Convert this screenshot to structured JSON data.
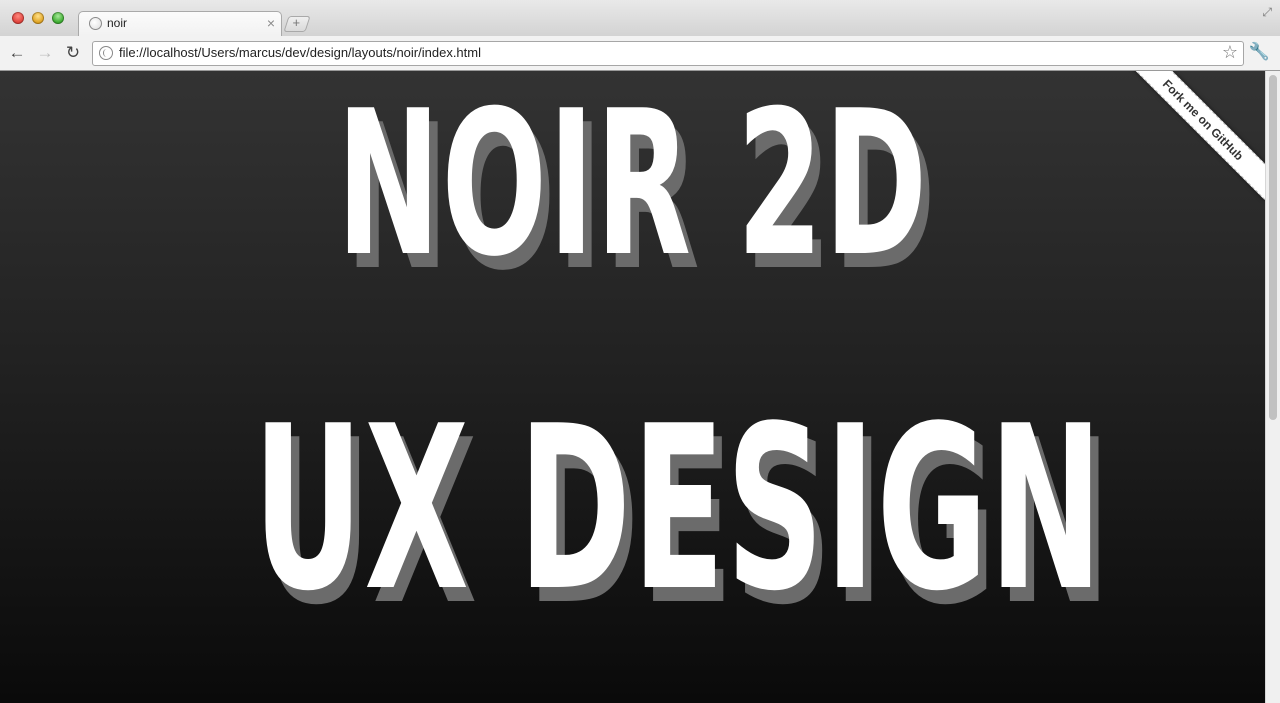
{
  "browser": {
    "tab": {
      "title": "noir",
      "close_glyph": "×"
    },
    "new_tab_glyph": "+",
    "fullscreen_glyph": "⤢",
    "nav": {
      "back_glyph": "←",
      "forward_glyph": "→",
      "reload_glyph": "↻"
    },
    "address_bar": {
      "url": "file://localhost/Users/marcus/dev/design/layouts/noir/index.html"
    },
    "star_glyph": "☆",
    "menu_glyph": "🔧"
  },
  "page": {
    "headline_line1": "NOIR 2D",
    "headline_line2": "UX DESIGN",
    "ribbon_text": "Fork me on GitHub",
    "colors": {
      "background_top": "#333333",
      "background_bottom": "#0a0a0a",
      "headline": "#ffffff",
      "headline_shadow": "#6b6b6b"
    }
  }
}
